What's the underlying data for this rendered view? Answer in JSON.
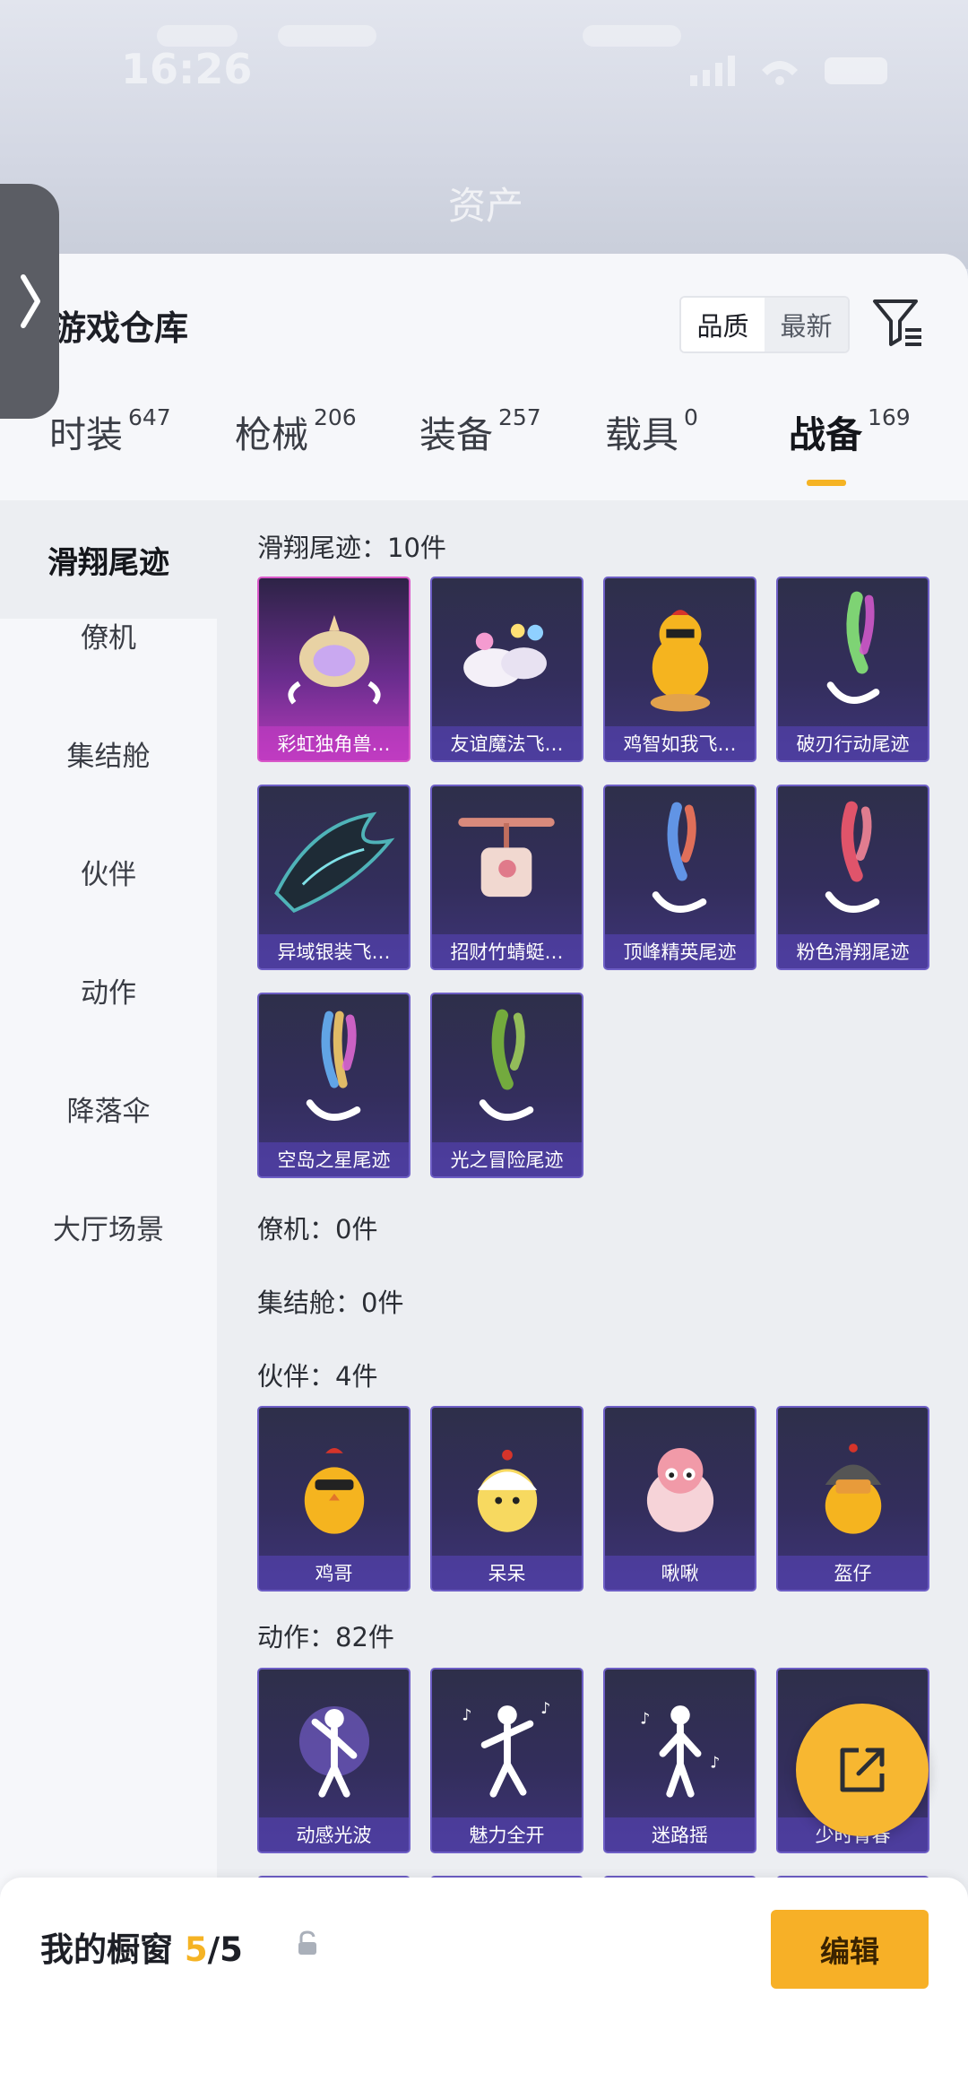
{
  "status_bar": {
    "time": "16:26"
  },
  "backdrop": {
    "title": "资产"
  },
  "header": {
    "title": "游戏仓库",
    "sort_options": [
      "品质",
      "最新"
    ]
  },
  "tabs": [
    {
      "label": "时装",
      "count": "647"
    },
    {
      "label": "枪械",
      "count": "206"
    },
    {
      "label": "装备",
      "count": "257"
    },
    {
      "label": "载具",
      "count": "0"
    },
    {
      "label": "战备",
      "count": "169"
    }
  ],
  "active_tab": "战备",
  "sidebar": {
    "items": [
      "滑翔尾迹",
      "僚机",
      "集结舱",
      "伙伴",
      "动作",
      "降落伞",
      "大厅场景"
    ],
    "active": "滑翔尾迹"
  },
  "sections": {
    "glide_trail": {
      "title": "滑翔尾迹：10件",
      "items": [
        "彩虹独角兽…",
        "友谊魔法飞…",
        "鸡智如我飞…",
        "破刃行动尾迹",
        "异域银装飞…",
        "招财竹蜻蜓…",
        "顶峰精英尾迹",
        "粉色滑翔尾迹",
        "空岛之星尾迹",
        "光之冒险尾迹"
      ]
    },
    "wingman": {
      "title": "僚机：0件"
    },
    "capsule": {
      "title": "集结舱：0件"
    },
    "partner": {
      "title": "伙伴：4件",
      "items": [
        "鸡哥",
        "呆呆",
        "啾啾",
        "盔仔"
      ]
    },
    "emote": {
      "title": "动作：82件",
      "items": [
        "动感光波",
        "魅力全开",
        "迷路摇",
        "少时青春"
      ]
    }
  },
  "bottom_bar": {
    "label": "我的橱窗",
    "current": "5",
    "separator": "/",
    "total": "5",
    "edit_label": "编辑"
  },
  "colors": {
    "accent": "#f5b324",
    "card_purple": "#3e3478",
    "card_pink": "#b63bb9"
  }
}
